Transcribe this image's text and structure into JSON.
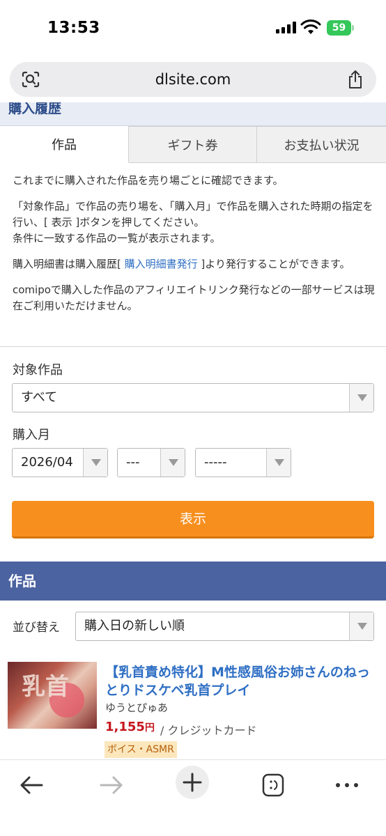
{
  "status_bar": {
    "time": "13:53",
    "battery": "59"
  },
  "browser": {
    "url": "dlsite.com"
  },
  "page": {
    "header_title": "購入履歴",
    "tabs": [
      {
        "label": "作品"
      },
      {
        "label": "ギフト券"
      },
      {
        "label": "お支払い状況"
      }
    ],
    "description": {
      "p1": "これまでに購入された作品を売り場ごとに確認できます。",
      "p2": "「対象作品」で作品の売り場を、「購入月」で作品を購入された時期の指定を行い、[ 表示 ]ボタンを押してください。",
      "p2b": "条件に一致する作品の一覧が表示されます。",
      "p3_before": "購入明細書は購入履歴[ ",
      "p3_link": "購入明細書発行",
      "p3_after": " ]より発行することができます。",
      "p4": "comipoで購入した作品のアフィリエイトリンク発行などの一部サービスは現在ご利用いただけません。"
    },
    "form": {
      "target_label": "対象作品",
      "target_value": "すべて",
      "month_label": "購入月",
      "year_month_value": "2026/04",
      "day_value": "---",
      "extra_value": "-----",
      "show_button": "表示"
    },
    "works": {
      "section_title": "作品",
      "sort_label": "並び替え",
      "sort_value": "購入日の新しい順",
      "items": [
        {
          "title": "【乳首責め特化】M性感風俗お姉さんのねっとりドスケベ乳首プレイ",
          "author": "ゆうとぴゅあ",
          "price": "1,155",
          "price_unit": "円",
          "payment": "/ クレジットカード",
          "tag": "ボイス・ASMR",
          "thumb_text": "乳首"
        }
      ]
    }
  },
  "colors": {
    "accent_orange": "#f78f1e",
    "section_blue": "#4b63a0",
    "link_blue": "#2f6fc4",
    "price_red": "#c5161d",
    "battery_green": "#34c759"
  },
  "icons": [
    "lens-icon",
    "share-icon",
    "back-icon",
    "forward-icon",
    "plus-icon",
    "tabs-icon",
    "more-icon",
    "wifi-icon",
    "signal-icon",
    "battery-icon"
  ]
}
